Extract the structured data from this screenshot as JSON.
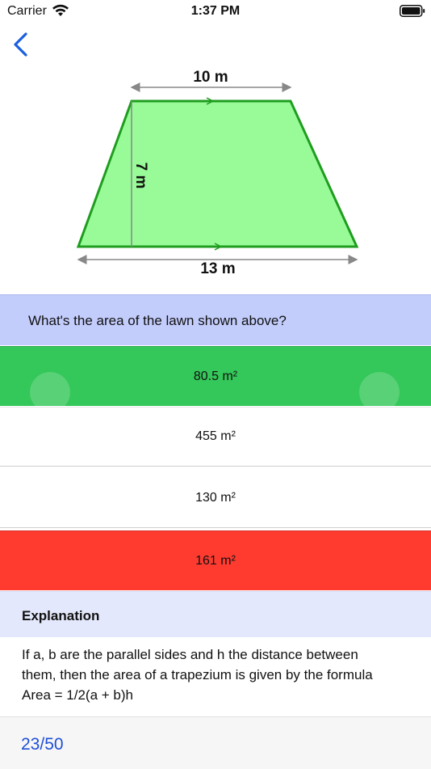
{
  "status_bar": {
    "carrier": "Carrier",
    "time": "1:37 PM"
  },
  "nav": {
    "back_icon": "chevron-left-icon"
  },
  "figure": {
    "top_label": "10 m",
    "bottom_label": "13 m",
    "height_label": "7 m",
    "fill_color": "#98fb98",
    "stroke_color": "#1f9d1f"
  },
  "question": {
    "text": "What's the area of the lawn shown above?"
  },
  "answers": [
    {
      "label": "80.5 m²",
      "state": "correct",
      "color": "#34c759"
    },
    {
      "label": "455 m²",
      "state": "neutral",
      "color": "#ffffff"
    },
    {
      "label": "130 m²",
      "state": "neutral",
      "color": "#ffffff"
    },
    {
      "label": "161 m²",
      "state": "wrong",
      "color": "#ff3b30"
    }
  ],
  "explanation": {
    "title": "Explanation",
    "lines": [
      "If a, b are the parallel sides and h the distance between",
      "them, then the area of a trapezium is given by the formula",
      "Area = 1/2(a + b)h"
    ]
  },
  "footer": {
    "progress": "23/50",
    "accent_color": "#1e4fd6"
  }
}
